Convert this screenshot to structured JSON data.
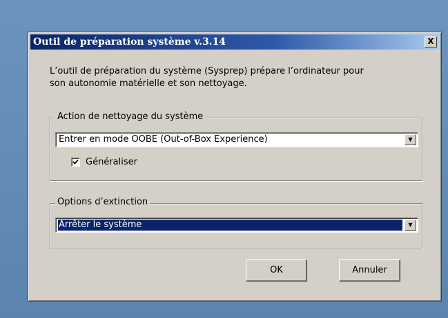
{
  "dialog": {
    "title": "Outil de préparation système v.3.14",
    "close_label": "X",
    "description_line1": "L’outil de préparation du système (Sysprep) prépare l’ordinateur pour",
    "description_line2": "son autonomie matérielle et son nettoyage."
  },
  "cleanup_group": {
    "legend": "Action de nettoyage du système",
    "selected_value": "Entrer en mode OOBE (Out-of-Box Experience)",
    "generalize_label": "Généraliser",
    "generalize_checked": true
  },
  "shutdown_group": {
    "legend": "Options d’extinction",
    "selected_value": "Arrêter le système"
  },
  "buttons": {
    "ok": "OK",
    "cancel": "Annuler"
  },
  "icons": {
    "close": "close-icon",
    "dropdown": "chevron-down-icon",
    "check": "checkmark-icon"
  },
  "colors": {
    "titlebar_start": "#0a246a",
    "titlebar_end": "#a6caf0",
    "dialog_bg": "#d4d0c8",
    "selection_bg": "#0a246a",
    "desktop_bg": "#5d87b2"
  }
}
